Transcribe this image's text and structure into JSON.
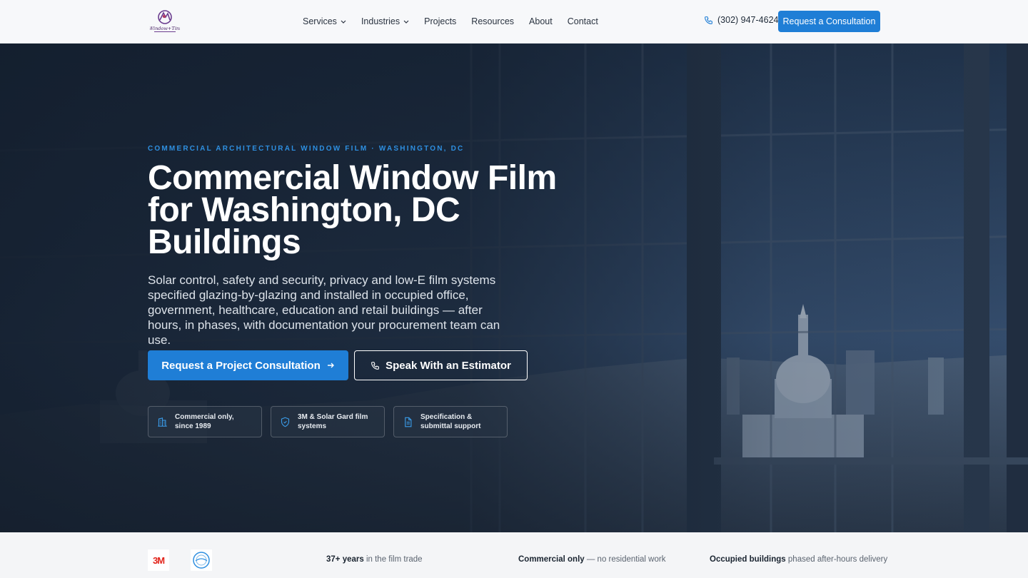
{
  "header": {
    "logo_text": "Window Tint",
    "nav": [
      {
        "label": "Services",
        "dropdown": true
      },
      {
        "label": "Industries",
        "dropdown": true
      },
      {
        "label": "Projects",
        "dropdown": false
      },
      {
        "label": "Resources",
        "dropdown": false
      },
      {
        "label": "About",
        "dropdown": false
      },
      {
        "label": "Contact",
        "dropdown": false
      }
    ],
    "phone": "(302) 947-4624",
    "cta": "Request a Consultation"
  },
  "hero": {
    "eyebrow": "COMMERCIAL ARCHITECTURAL WINDOW FILM · WASHINGTON, DC",
    "title": "Commercial Window Film for Washington, DC Buildings",
    "subtitle": "Solar control, safety and security, privacy and low-E film systems specified glazing-by-glazing and installed in occupied office, government, healthcare, education and retail buildings — after hours, in phases, with documentation your procurement team can use.",
    "primary_button": "Request a Project Consultation",
    "secondary_button": "Speak With an Estimator",
    "badges": [
      {
        "icon": "building-icon",
        "text": "Commercial only, since 1989"
      },
      {
        "icon": "shield-icon",
        "text": "3M & Solar Gard film systems"
      },
      {
        "icon": "document-icon",
        "text": "Specification & submittal support"
      }
    ]
  },
  "trust": {
    "brand_3m": "3M",
    "items": [
      {
        "bold": "37+ years",
        "rest": " in the film trade"
      },
      {
        "bold": "Commercial only",
        "rest": " — no residential work"
      },
      {
        "bold": "Occupied buildings",
        "rest": " phased after-hours delivery"
      }
    ]
  },
  "colors": {
    "accent": "#1f7ed6",
    "eyebrow": "#2e8fe0",
    "hero_bg": "#1a2638",
    "header_bg": "#f7f8fa"
  }
}
